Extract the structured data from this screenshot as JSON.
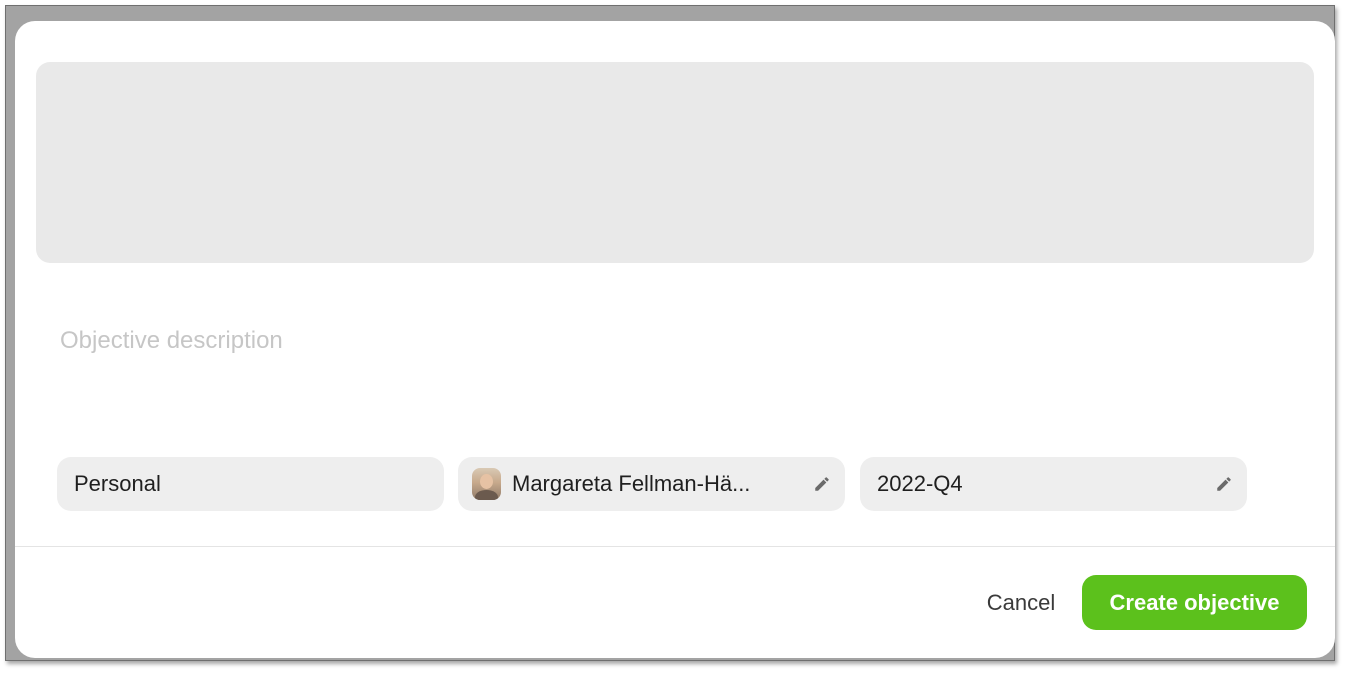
{
  "form": {
    "description_placeholder": "Objective description",
    "type_chip": {
      "label": "Personal"
    },
    "owner_chip": {
      "label": "Margareta Fellman-Hä...",
      "avatar": "avatar",
      "icon": "pencil-icon"
    },
    "period_chip": {
      "label": "2022-Q4",
      "icon": "pencil-icon"
    }
  },
  "footer": {
    "cancel_label": "Cancel",
    "create_label": "Create objective"
  },
  "colors": {
    "accent": "#5cc11c",
    "chip_background": "#eeeeee",
    "cover_placeholder": "#e9e9e9"
  }
}
